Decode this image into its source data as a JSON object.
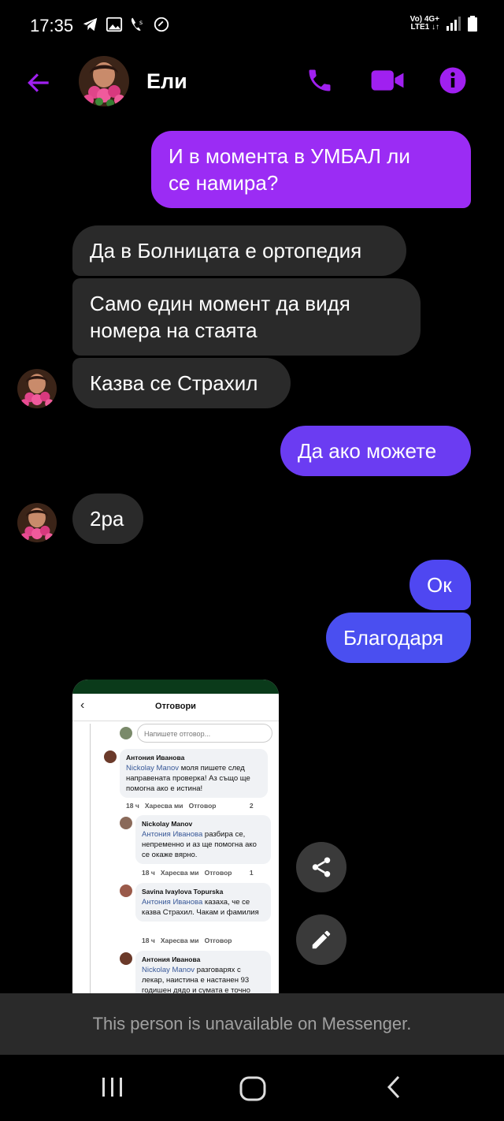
{
  "status_bar": {
    "time": "17:35",
    "network_top": "Vo) 4G+",
    "network_bottom": "LTE1 ↓↑"
  },
  "header": {
    "contact_name": "Ели",
    "icons": [
      "back-arrow-icon",
      "phone-icon",
      "video-camera-icon",
      "info-icon"
    ]
  },
  "colors": {
    "accent": "#a020f0",
    "outgoing_top": "#9b2cf4",
    "outgoing_mid": "#6b3cf2",
    "outgoing_bottom": "#4a4ff0",
    "incoming": "#2a2a2a"
  },
  "messages": [
    {
      "dir": "out",
      "text_1": "И в момента в УМБАЛ ли",
      "text_2": "се намира?"
    },
    {
      "dir": "in",
      "text": "Да в Болницата е ортопедия"
    },
    {
      "dir": "in",
      "text_1": "Само един момент да видя",
      "text_2": "номера на стаята"
    },
    {
      "dir": "in",
      "text": "Казва се Страхил"
    },
    {
      "dir": "out",
      "text": "Да ако можете"
    },
    {
      "dir": "in",
      "text": "2ра"
    },
    {
      "dir": "out",
      "text": "Ок"
    },
    {
      "dir": "out",
      "text": "Благодаря"
    }
  ],
  "shared_image": {
    "title": "Отговори",
    "reply_placeholder": "Напишете отговор...",
    "comments": [
      {
        "name": "Антония Иванова",
        "tag": "Nickolay Manov",
        "text": " моля пишете след направената проверка! Аз също ще помогна ако е истина!",
        "time": "18 ч",
        "like": "Харесва ми",
        "reply": "Отговор",
        "count": "2"
      },
      {
        "name": "Nickolay Manov",
        "tag": "Антония Иванова",
        "text": " разбира се, непременно и аз ще помогна ако се окаже вярно.",
        "time": "18 ч",
        "like": "Харесва ми",
        "reply": "Отговор",
        "count": "1"
      },
      {
        "name": "Savina Ivaylova Topurska",
        "tag": "Антония Иванова",
        "text": " казаха, че се казва Страхил. Чакам и фамилия",
        "time": "18 ч",
        "like": "Харесва ми",
        "reply": "Отговор"
      },
      {
        "name": "Антония Иванова",
        "tag": "Nickolay Manov",
        "text": " разговарях с лекар, наистина е настанен 93 годишен дядо и сумата е точно"
      }
    ]
  },
  "actions": {
    "share": "share-icon",
    "edit": "pencil-icon"
  },
  "banner": {
    "text": "This person is unavailable on Messenger."
  },
  "nav": {
    "recents": "recents-icon",
    "home": "home-icon",
    "back": "back-icon"
  }
}
